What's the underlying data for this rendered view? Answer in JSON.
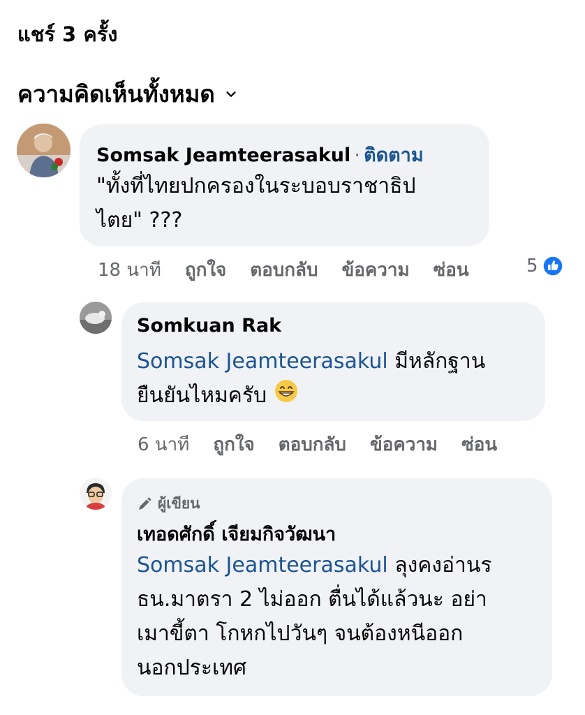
{
  "shares_text": "แชร์ 3 ครั้ง",
  "filter_label": "ความคิดเห็นทั้งหมด",
  "comments": [
    {
      "author": "Somsak Jeamteerasakul",
      "separator": "·",
      "follow_label": "ติดตาม",
      "text_line1": "\"ทั้งที่ไทยปกครองในระบอบราชาธิป",
      "text_line2": "ไตย\" ???",
      "time": "18 นาที",
      "like_label": "ถูกใจ",
      "reply_label": "ตอบกลับ",
      "message_label": "ข้อความ",
      "hide_label": "ซ่อน",
      "reaction_count": "5",
      "reaction_color": "#1877f2"
    },
    {
      "author": "Somkuan Rak",
      "mention": "Somsak Jeamteerasakul",
      "text_line1_rest": " มีหลักฐาน",
      "text_line2": "ยืนยันไหมครับ",
      "emoji": "😁",
      "time": "6 นาที",
      "like_label": "ถูกใจ",
      "reply_label": "ตอบกลับ",
      "message_label": "ข้อความ",
      "hide_label": "ซ่อน"
    },
    {
      "badge_label": "ผู้เขียน",
      "author": "เทอดศักดิ์ เจียมกิจวัฒนา",
      "mention": "Somsak Jeamteerasakul",
      "text_line1_rest": " ลุงคงอ่านร",
      "text_line2": "ธน.มาตรา 2 ไม่ออก ตื่นได้แล้วนะ อย่า",
      "text_line3": "เมาขี้ตา โกหกไปวันๆ จนต้องหนีออก",
      "text_line4": "นอกประเทศ"
    }
  ],
  "colors": {
    "bubble": "#f0f2f5",
    "mention": "#1b5491",
    "meta": "#65676b"
  }
}
